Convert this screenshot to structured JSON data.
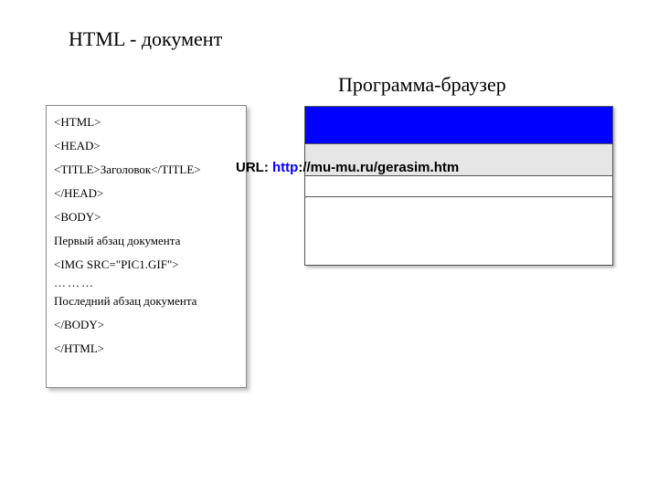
{
  "headings": {
    "left": "HTML - документ",
    "right": "Программа-браузер"
  },
  "document_source": {
    "lines": [
      "<HTML>",
      "<HEAD>",
      "<TITLE>Заголовок</TITLE>",
      "</HEAD>",
      "<BODY>",
      "Первый абзац документа",
      "<IMG SRC=\"PIC1.GIF\">",
      "………",
      "Последний абзац документа",
      "</BODY>",
      "</HTML>"
    ]
  },
  "url": {
    "prefix": "URL: ",
    "protocol": "http",
    "rest": "://mu-mu.ru/gerasim.htm"
  },
  "browser": {
    "titlebar_color": "#0000ff",
    "address_bg": "#e6e6e6"
  }
}
